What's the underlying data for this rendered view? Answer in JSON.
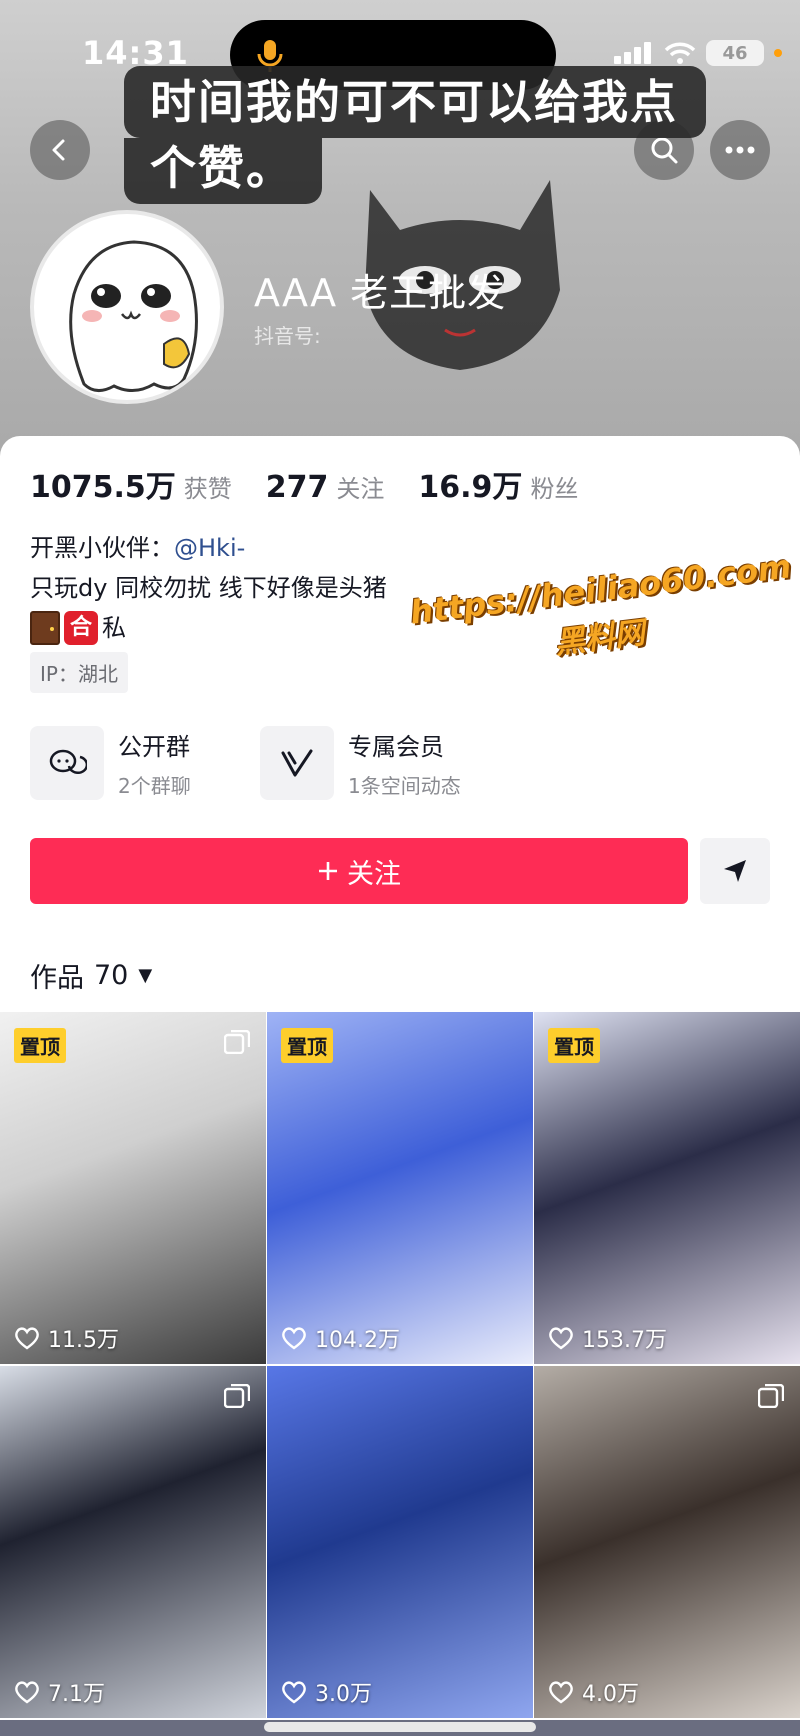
{
  "status_bar": {
    "time": "14:31",
    "battery": "46"
  },
  "caption": {
    "line1": "时间我的可不可以给我点",
    "line2": "个赞。"
  },
  "profile": {
    "nickname": "AAA 老王批发",
    "douyin_id_label": "抖音号:"
  },
  "stats": [
    {
      "value": "1075.5万",
      "label": "获赞"
    },
    {
      "value": "277",
      "label": "关注"
    },
    {
      "value": "16.9万",
      "label": "粉丝"
    }
  ],
  "bio": {
    "line1_prefix": "开黑小伙伴：",
    "line1_mention": "@Hki-",
    "line2": "只玩dy  同校勿扰  线下好像是头猪",
    "line3_emoji_text": "合",
    "line3_suffix": "私",
    "ip": "IP：湖北"
  },
  "watermark": {
    "url": "https://heiliao60.com",
    "name": "黑料网"
  },
  "features": [
    {
      "title": "公开群",
      "subtitle": "2个群聊",
      "icon": "chat-bubbles-icon"
    },
    {
      "title": "专属会员",
      "subtitle": "1条空间动态",
      "icon": "v-member-icon"
    }
  ],
  "follow_label": "关注",
  "works": {
    "label": "作品",
    "count": "70"
  },
  "pin_label": "置顶",
  "videos": [
    {
      "likes": "11.5万",
      "pinned": true,
      "multi": true,
      "bg": "linear-gradient(160deg,#f1f1f1 0%,#cfcfcf 40%,#3a3a3a 100%)"
    },
    {
      "likes": "104.2万",
      "pinned": true,
      "multi": false,
      "bg": "linear-gradient(160deg,#9fb3f5 0%,#3e5fd8 45%,#e9ecfb 100%)"
    },
    {
      "likes": "153.7万",
      "pinned": true,
      "multi": false,
      "bg": "linear-gradient(160deg,#dfe2f2 0%,#2b2d48 45%,#e6e1ee 100%)"
    },
    {
      "likes": "7.1万",
      "pinned": false,
      "multi": true,
      "bg": "linear-gradient(160deg,#d8dde6 0%,#1f2230 40%,#cfd3db 100%)"
    },
    {
      "likes": "3.0万",
      "pinned": false,
      "multi": false,
      "bg": "linear-gradient(160deg,#5877e6 0%,#203a8f 45%,#8fa6ef 100%)"
    },
    {
      "likes": "4.0万",
      "pinned": false,
      "multi": true,
      "bg": "linear-gradient(160deg,#b4ada6 0%,#3a302b 45%,#d9d2cb 100%)"
    }
  ],
  "colors": {
    "accent": "#fe2c55",
    "pin": "#fece2c",
    "watermark": "#f5a623"
  }
}
